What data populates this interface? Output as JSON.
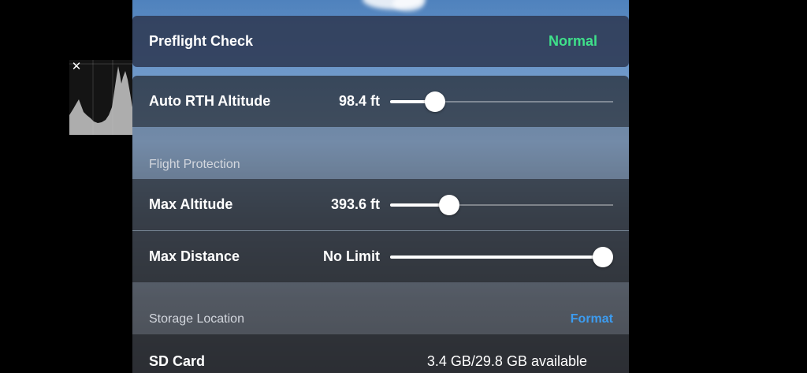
{
  "preflight": {
    "title": "Preflight Check",
    "status": "Normal",
    "status_color": "#3fe08a"
  },
  "rth": {
    "label": "Auto RTH Altitude",
    "value": "98.4 ft",
    "slider_fraction": 0.17
  },
  "flight_protection": {
    "section_label": "Flight Protection",
    "max_altitude": {
      "label": "Max Altitude",
      "value": "393.6 ft",
      "slider_fraction": 0.24
    },
    "max_distance": {
      "label": "Max Distance",
      "value": "No Limit",
      "slider_fraction": 1.0
    }
  },
  "storage": {
    "section_label": "Storage Location",
    "format_label": "Format",
    "sd_card_label": "SD Card",
    "sd_card_value": "3.4 GB/29.8 GB available"
  },
  "histogram": {
    "close_glyph": "✕",
    "icon": "close-icon"
  },
  "colors": {
    "accent_link": "#3c9cf0",
    "status_ok": "#3fe08a"
  }
}
